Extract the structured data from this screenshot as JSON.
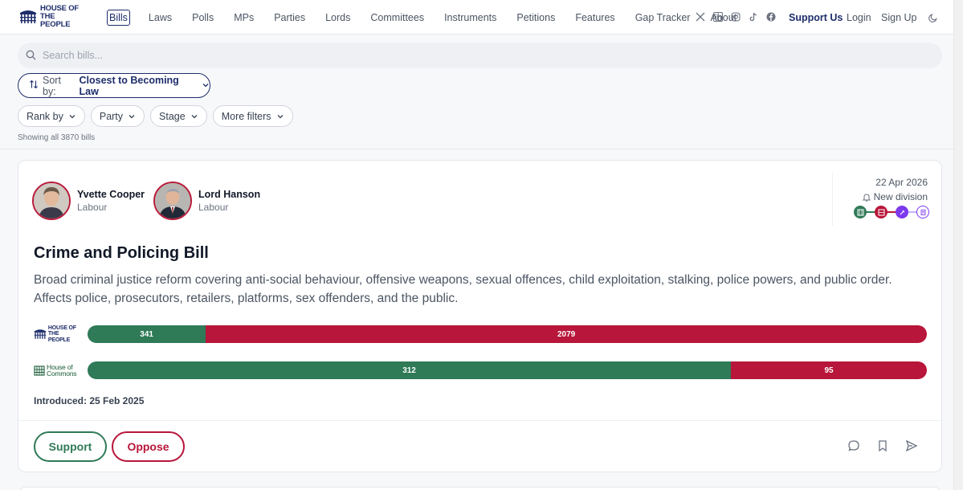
{
  "nav": {
    "logo_line1": "HOUSE OF",
    "logo_line2": "THE PEOPLE",
    "links": [
      "Bills",
      "Laws",
      "Polls",
      "MPs",
      "Parties",
      "Lords",
      "Committees",
      "Instruments",
      "Petitions",
      "Features",
      "Gap Tracker",
      "About"
    ],
    "social": [
      "x-icon",
      "linkedin-icon",
      "instagram-icon",
      "tiktok-icon",
      "facebook-icon"
    ],
    "support": "Support Us",
    "login": "Login",
    "signup": "Sign Up",
    "theme_icon": "moon-icon"
  },
  "search": {
    "placeholder": "Search bills..."
  },
  "sort": {
    "prefix": "Sort by:",
    "value": "Closest to Becoming Law"
  },
  "filters": [
    "Rank by",
    "Party",
    "Stage",
    "More filters"
  ],
  "showing": "Showing all 3870 bills",
  "bill": {
    "sponsors": [
      {
        "name": "Yvette Cooper",
        "party": "Labour"
      },
      {
        "name": "Lord Hanson",
        "party": "Labour"
      }
    ],
    "date": "22 Apr 2026",
    "status": "New division",
    "stages": [
      {
        "icon": "commons-icon",
        "color": "#2f7a57"
      },
      {
        "icon": "lords-icon",
        "color": "#b8163a"
      },
      {
        "icon": "royal-assent-icon",
        "color": "#7c3aed"
      },
      {
        "icon": "act-icon",
        "color": "#7c3aed"
      }
    ],
    "title": "Crime and Policing Bill",
    "description": "Broad criminal justice reform covering anti-social behaviour, offensive weapons, sexual offences, child exploitation, stalking, police powers, and public order. Affects police, prosecutors, retailers, platforms, sex offenders, and the public.",
    "votes": [
      {
        "source": "House of the People",
        "logo_line1": "HOUSE OF",
        "logo_line2": "THE PEOPLE",
        "support": 341,
        "oppose": 2079
      },
      {
        "source": "House of Commons",
        "logo_line1": "House of",
        "logo_line2": "Commons",
        "support": 312,
        "oppose": 95
      }
    ],
    "introduced": "Introduced: 25 Feb 2025",
    "support_label": "Support",
    "oppose_label": "Oppose",
    "actions": [
      "comment-icon",
      "bookmark-icon",
      "share-icon"
    ]
  },
  "colors": {
    "brand": "#1e2d6b",
    "support": "#2f7a57",
    "oppose": "#b8163a"
  }
}
